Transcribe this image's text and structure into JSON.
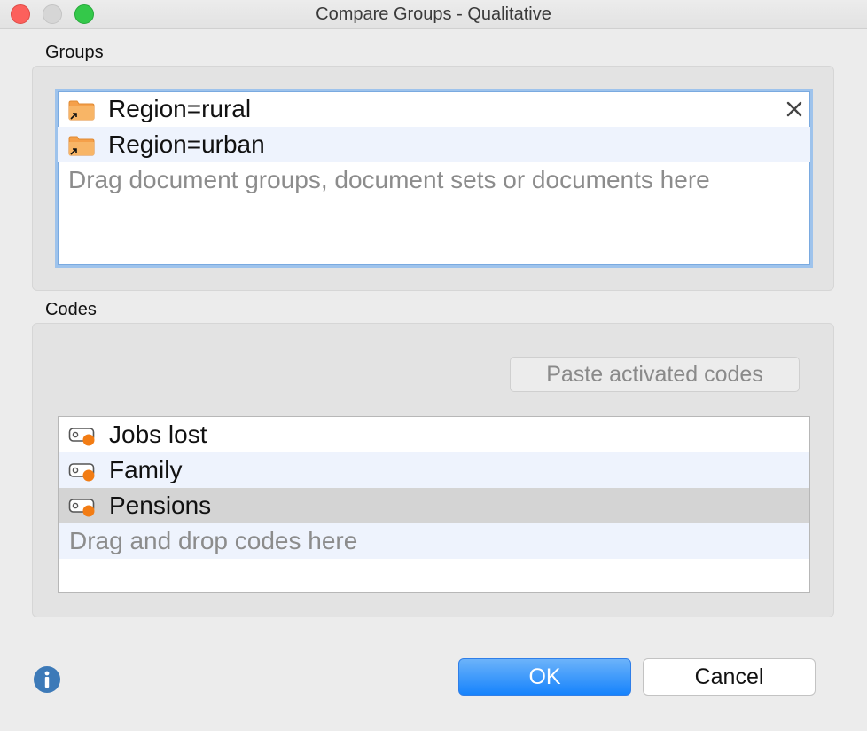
{
  "window": {
    "title": "Compare Groups - Qualitative"
  },
  "groups": {
    "label": "Groups",
    "items": [
      {
        "label": "Region=rural",
        "icon": "folder-link-icon"
      },
      {
        "label": "Region=urban",
        "icon": "folder-link-icon"
      }
    ],
    "placeholder": "Drag document groups, document sets or documents here",
    "remove_icon": "close-icon"
  },
  "codes": {
    "label": "Codes",
    "paste_button": "Paste activated codes",
    "items": [
      {
        "label": "Jobs lost",
        "icon": "code-icon"
      },
      {
        "label": "Family",
        "icon": "code-icon"
      },
      {
        "label": "Pensions",
        "icon": "code-icon",
        "selected": true
      }
    ],
    "placeholder": "Drag and drop codes here"
  },
  "footer": {
    "ok_label": "OK",
    "cancel_label": "Cancel",
    "info_icon": "info-icon"
  },
  "colors": {
    "accent": "#1683fc",
    "folder": "#f5a04a",
    "code_dot": "#f27c14",
    "info": "#3d7ab8"
  }
}
